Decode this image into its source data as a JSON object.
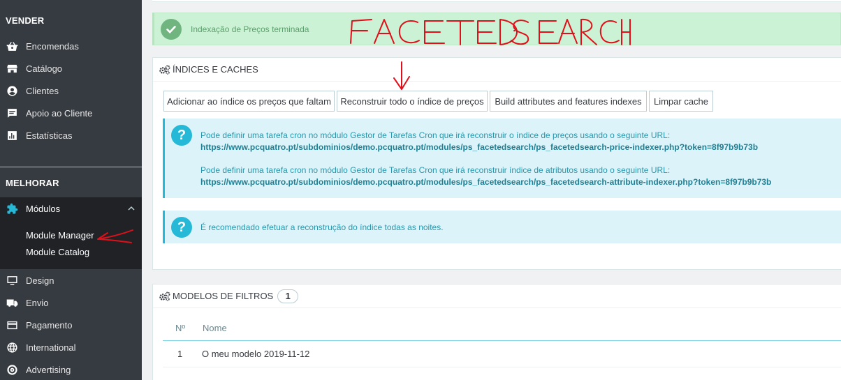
{
  "sidebar": {
    "section_sell": "VENDER",
    "sell_items": [
      {
        "label": "Encomendas",
        "icon": "basket-icon"
      },
      {
        "label": "Catálogo",
        "icon": "store-icon"
      },
      {
        "label": "Clientes",
        "icon": "user-circle-icon"
      },
      {
        "label": "Apoio ao Cliente",
        "icon": "chat-icon"
      },
      {
        "label": "Estatísticas",
        "icon": "bar-chart-icon"
      }
    ],
    "section_improve": "MELHORAR",
    "modules": {
      "label": "Módulos",
      "icon": "puzzle-icon",
      "subitems": [
        "Module Manager",
        "Module Catalog"
      ]
    },
    "improve_items": [
      {
        "label": "Design",
        "icon": "monitor-icon"
      },
      {
        "label": "Envio",
        "icon": "truck-icon"
      },
      {
        "label": "Pagamento",
        "icon": "credit-card-icon"
      },
      {
        "label": "International",
        "icon": "globe-icon"
      },
      {
        "label": "Advertising",
        "icon": "target-icon"
      }
    ]
  },
  "alert": {
    "message": "Indexação de Preços terminada"
  },
  "annotation": {
    "handwritten_title": "FACETED SEARCH"
  },
  "indexes_panel": {
    "title": "ÍNDICES E CACHES",
    "buttons": [
      "Adicionar ao índice os preços que faltam",
      "Reconstruir todo o índice de preços",
      "Build attributes and features indexes",
      "Limpar cache"
    ],
    "info_price_text": "Pode definir uma tarefa cron no módulo Gestor de Tarefas Cron que irá reconstruir o índice de preços usando o seguinte URL:",
    "info_price_url": "https://www.pcquatro.pt/subdominios/demo.pcquatro.pt/modules/ps_facetedsearch/ps_facetedsearch-price-indexer.php?token=8f97b9b73b",
    "info_attr_text": "Pode definir uma tarefa cron no módulo Gestor de Tarefas Cron que irá reconstruir índice de atributos usando o seguinte URL:",
    "info_attr_url": "https://www.pcquatro.pt/subdominios/demo.pcquatro.pt/modules/ps_facetedsearch/ps_facetedsearch-attribute-indexer.php?token=8f97b9b73b",
    "recommend_text": "É recomendado efetuar a reconstrução do índice todas as noites."
  },
  "filters_panel": {
    "title": "MODELOS DE FILTROS",
    "count": "1",
    "columns": [
      "Nº",
      "Nome"
    ],
    "rows": [
      {
        "id": "1",
        "name": "O meu modelo 2019-11-12"
      }
    ]
  },
  "colors": {
    "sidebar_bg": "#363a41",
    "sidebar_active": "#202226",
    "info_accent": "#25b9d7",
    "success_bg": "#cbf2d4",
    "annotation_red": "#e0101a"
  }
}
